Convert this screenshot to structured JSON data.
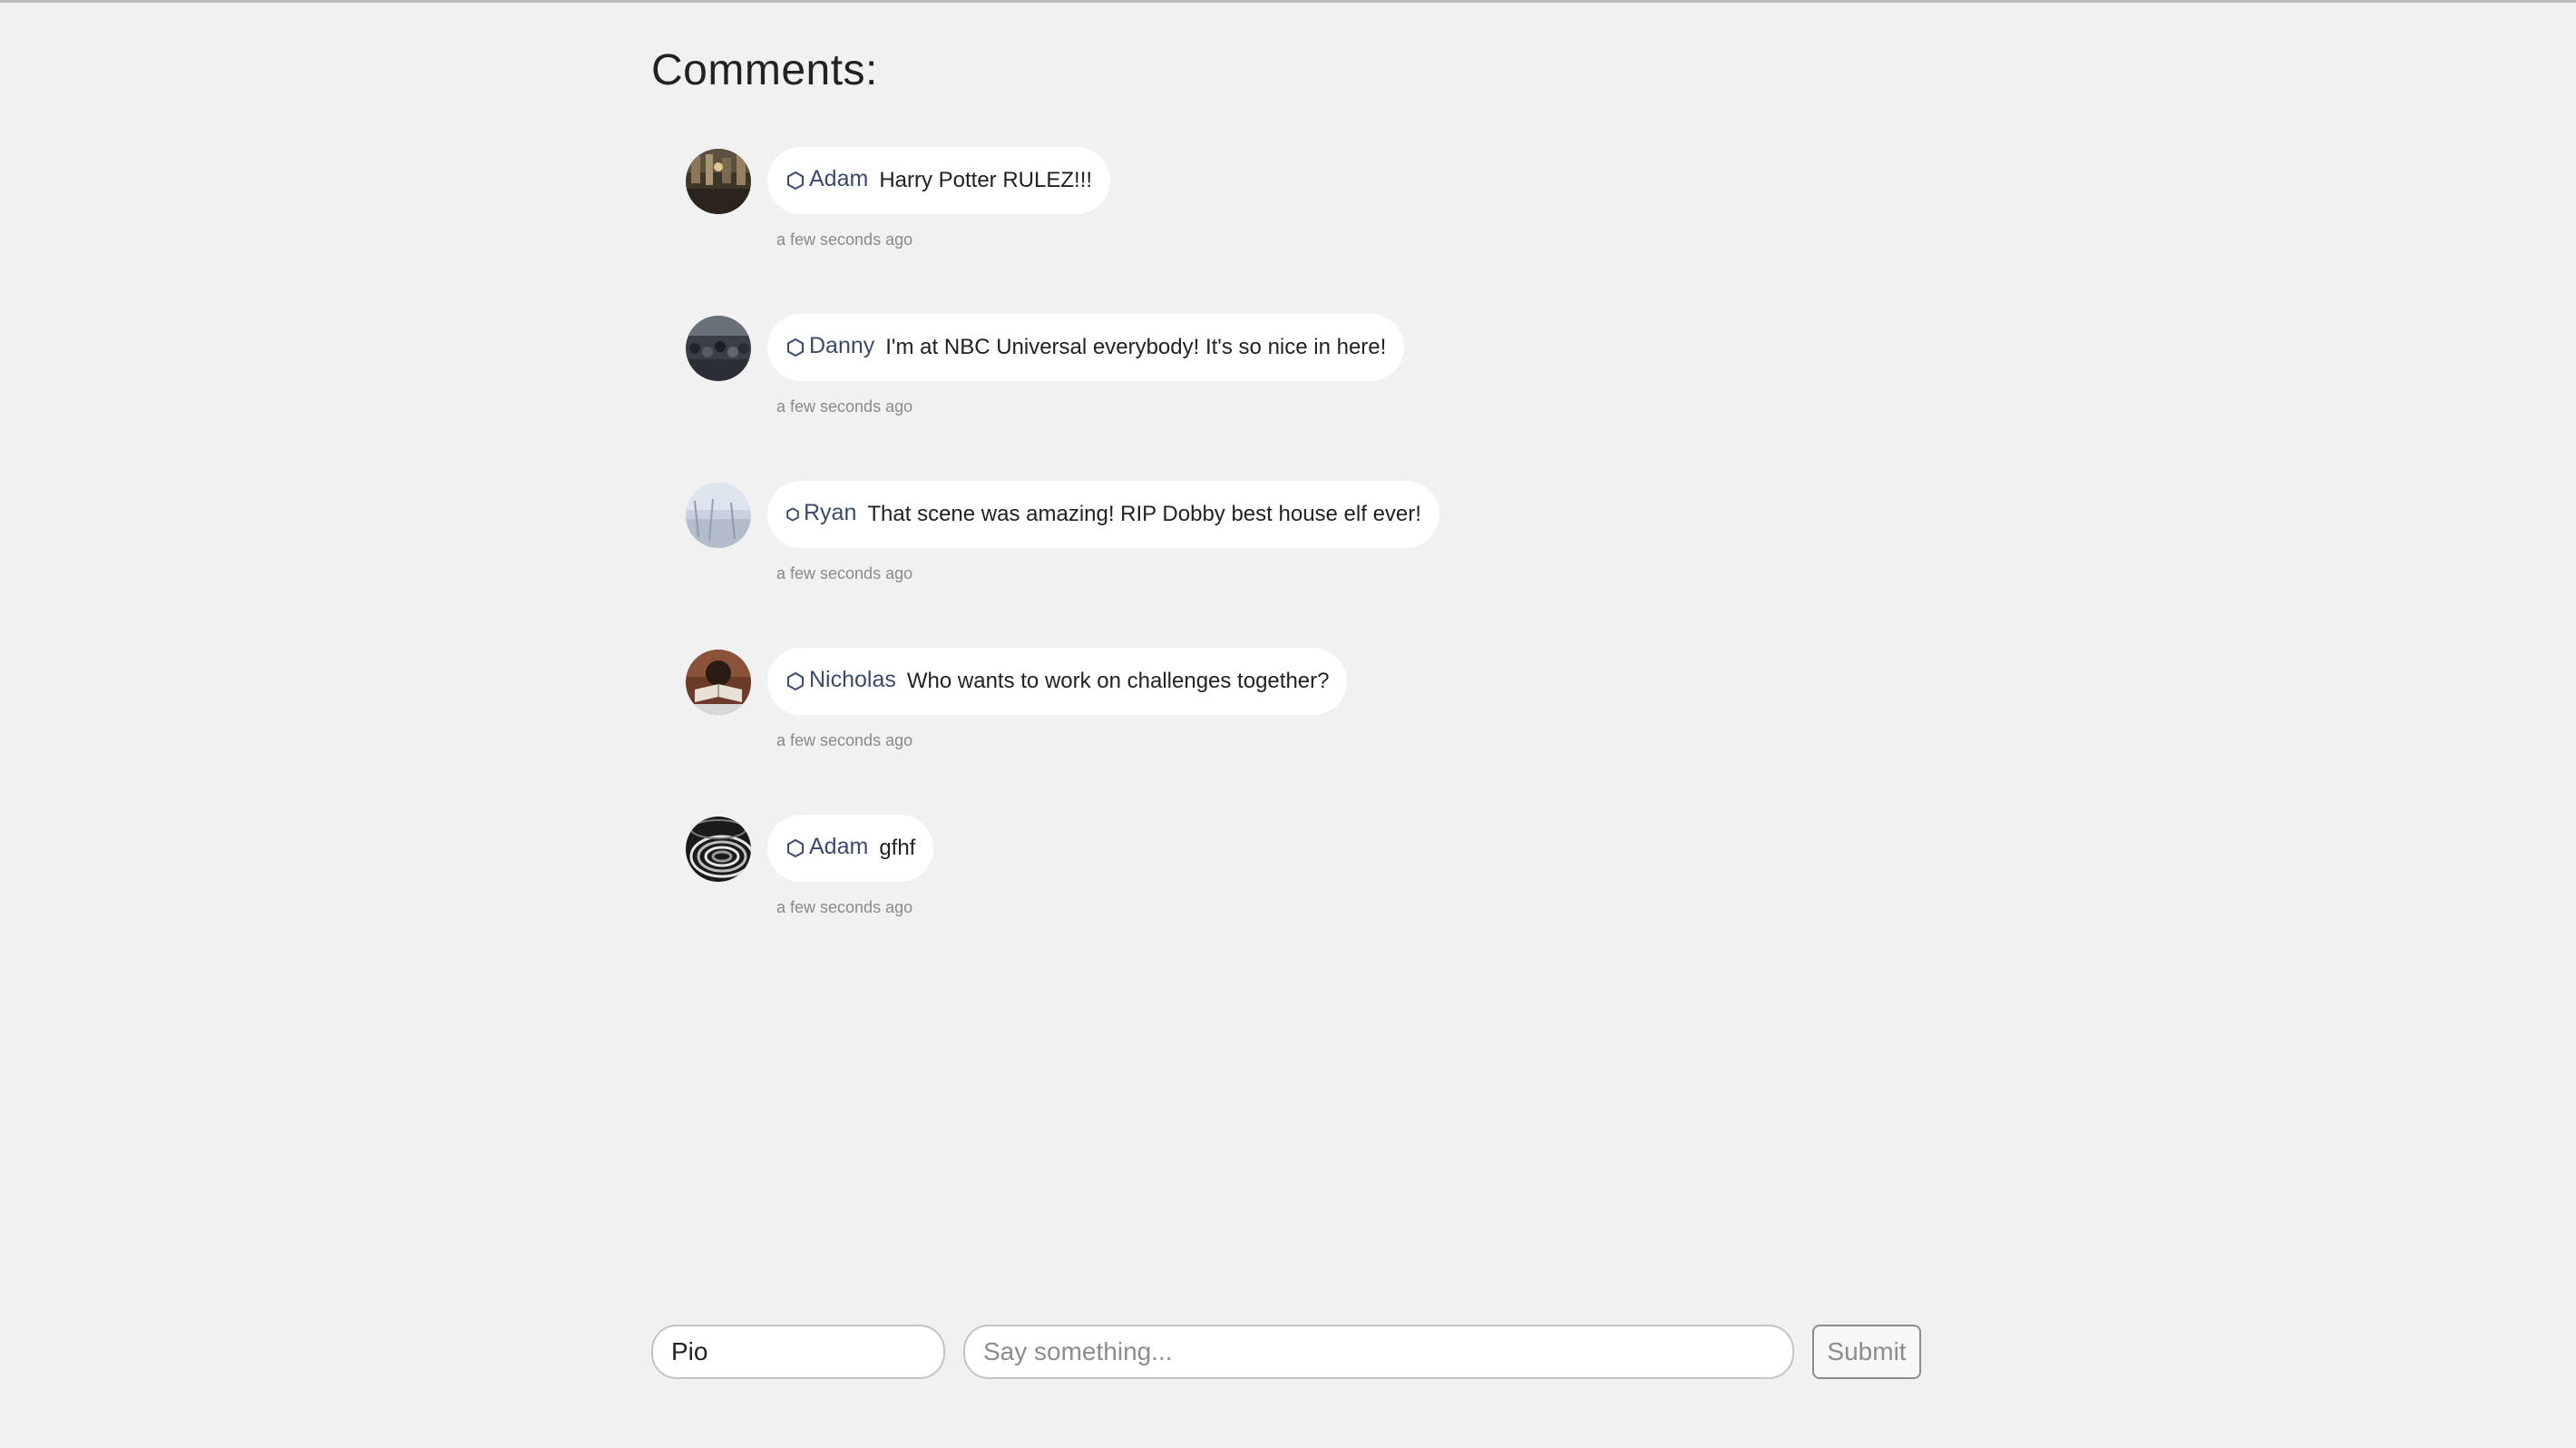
{
  "heading": "Comments:",
  "comments": [
    {
      "author": "Adam",
      "text": "Harry Potter RULEZ!!!",
      "time": "a few seconds ago",
      "avatar": "library-photo",
      "icon": "hexagon-icon"
    },
    {
      "author": "Danny",
      "text": "I'm at NBC Universal everybody! It's so nice in here!",
      "time": "a few seconds ago",
      "avatar": "crowd-photo",
      "icon": "hexagon-icon"
    },
    {
      "author": "Ryan",
      "text": "That scene was amazing! RIP Dobby best house elf ever!",
      "time": "a few seconds ago",
      "avatar": "snow-field-photo",
      "icon": "hexagon-icon"
    },
    {
      "author": "Nicholas",
      "text": "Who wants to work on challenges together?",
      "time": "a few seconds ago",
      "avatar": "book-reader-photo",
      "icon": "hexagon-icon"
    },
    {
      "author": "Adam",
      "text": "gfhf",
      "time": "a few seconds ago",
      "avatar": "spiral-pattern-photo",
      "icon": "hexagon-icon"
    }
  ],
  "form": {
    "name_value": "Pio",
    "text_placeholder": "Say something...",
    "submit_label": "Submit"
  },
  "colors": {
    "background": "#f1f1f1",
    "author": "#3a4a6b",
    "bubble": "#ffffff",
    "timestamp": "#8a8a8a"
  }
}
